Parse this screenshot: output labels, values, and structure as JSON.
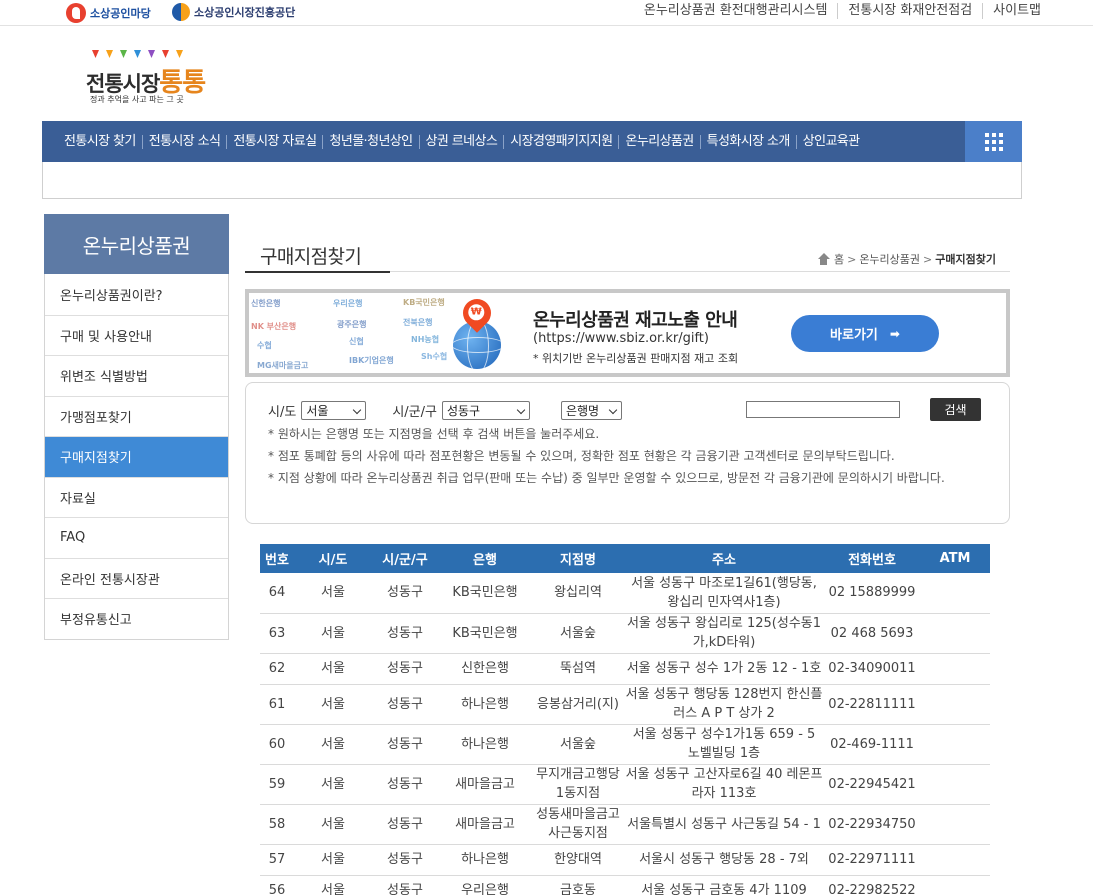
{
  "topbar": {
    "brand_a": "소상공인마당",
    "brand_b": "소상공인시장진흥공단",
    "links": [
      "온누리상품권 환전대행관리시스템",
      "전통시장 화재안전점검",
      "사이트맵"
    ]
  },
  "logo": {
    "title_main": "전통시장",
    "title_accent": "통통",
    "slogan": "정과 추억을 사고 파는 그 곳"
  },
  "gnb": {
    "items": [
      "전통시장 찾기",
      "전통시장 소식",
      "전통시장 자료실",
      "청년몰·청년상인",
      "상권 르네상스",
      "시장경영패키지지원",
      "온누리상품권",
      "특성화시장 소개",
      "상인교육관"
    ],
    "allmenu_icon": "grid-menu-icon"
  },
  "lnb": {
    "title": "온누리상품권",
    "items": [
      "온누리상품권이란?",
      "구매 및 사용안내",
      "위변조 식별방법",
      "가맹점포찾기",
      "구매지점찾기",
      "자료실",
      "FAQ",
      "온라인 전통시장관",
      "부정유통신고"
    ],
    "active_index": 4,
    "active_color": "#3f8ad6"
  },
  "content": {
    "title": "구매지점찾기",
    "breadcrumb": [
      "홈",
      "온누리상품권",
      "구매지점찾기"
    ]
  },
  "banner": {
    "title": "온누리상품권 재고노출 안내",
    "url": "(https://www.sbiz.or.kr/gift)",
    "desc": "* 위치기반 온누리상품권 판매지점 재고 조회",
    "button": "바로가기",
    "button_icon": "➡",
    "button_color": "#3a7dd4",
    "banks": [
      "신한은행",
      "우리은행",
      "KB국민은행",
      "NK 부산은행",
      "광주은행",
      "전북은행",
      "수협",
      "신협",
      "NH농협",
      "MG새마을금고",
      "IBK기업은행",
      "Sh수협"
    ]
  },
  "search": {
    "sido_label": "시/도",
    "sido_value": "서울",
    "sigungu_label": "시/군/구",
    "sigungu_value": "성동구",
    "bank_value": "은행명",
    "keyword_value": "",
    "button": "검색",
    "notes": [
      "* 원하시는 은행명 또는 지점명을 선택 후 검색 버튼을 눌러주세요.",
      "* 점포 통폐합 등의 사유에 따라 점포현황은 변동될 수 있으며, 정확한 점포 현황은 각 금융기관 고객센터로 문의부탁드립니다.",
      "* 지점 상황에 따라 온누리상품권 취급 업무(판매 또는 수납) 중 일부만 운영할 수 있으므로, 방문전 각 금융기관에 문의하시기 바랍니다."
    ]
  },
  "table": {
    "headers": [
      "번호",
      "시/도",
      "시/군/구",
      "은행",
      "지점명",
      "주소",
      "전화번호",
      "ATM"
    ],
    "header_color": "#2c6eb0",
    "rows": [
      [
        "64",
        "서울",
        "성동구",
        "KB국민은행",
        "왕십리역",
        "서울 성동구 마조로1길61(행당동, 왕십리 민자역사1층)",
        "02 15889999",
        ""
      ],
      [
        "63",
        "서울",
        "성동구",
        "KB국민은행",
        "서울숲",
        "서울 성동구 왕십리로 125(성수동1가,kD타워)",
        "02 468 5693",
        ""
      ],
      [
        "62",
        "서울",
        "성동구",
        "신한은행",
        "뚝섬역",
        "서울 성동구 성수 1가 2동 12 - 1호",
        "02-34090011",
        ""
      ],
      [
        "61",
        "서울",
        "성동구",
        "하나은행",
        "응봉삼거리(지)",
        "서울 성동구 행당동 128번지 한신플러스 A P T 상가 2",
        "02-22811111",
        ""
      ],
      [
        "60",
        "서울",
        "성동구",
        "하나은행",
        "서울숲",
        "서울 성동구 성수1가1동 659 - 5 노벨빌딩 1층",
        "02-469-1111",
        ""
      ],
      [
        "59",
        "서울",
        "성동구",
        "새마을금고",
        "무지개금고행당1동지점",
        "서울 성동구 고산자로6길 40 레몬프라자 113호",
        "02-22945421",
        ""
      ],
      [
        "58",
        "서울",
        "성동구",
        "새마을금고",
        "성동새마을금고 사근동지점",
        "서울특별시 성동구 사근동길 54 - 1",
        "02-22934750",
        ""
      ],
      [
        "57",
        "서울",
        "성동구",
        "하나은행",
        "한양대역",
        "서울시 성동구 행당동 28 - 7외",
        "02-22971111",
        ""
      ],
      [
        "56",
        "서울",
        "성동구",
        "우리은행",
        "금호동",
        "서울 성동구 금호동 4가 1109",
        "02-22982522",
        ""
      ]
    ]
  }
}
